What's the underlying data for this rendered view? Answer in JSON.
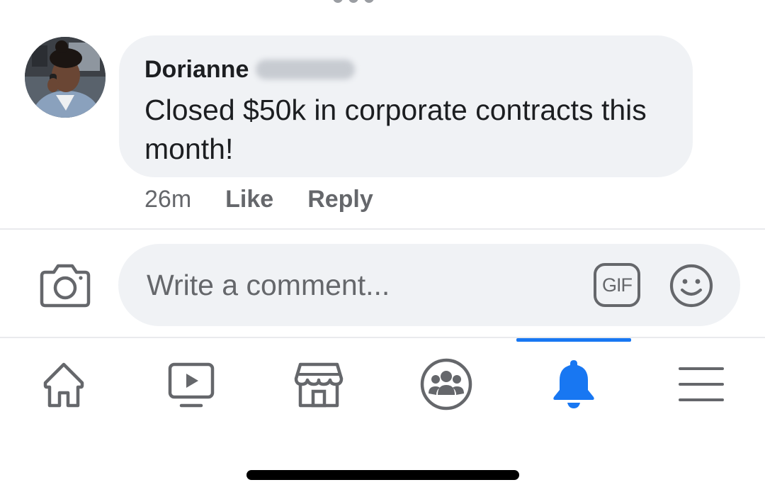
{
  "comment": {
    "author_name": "Dorianne",
    "text": "Closed $50k in corporate contracts this month!",
    "time": "26m",
    "like_label": "Like",
    "reply_label": "Reply"
  },
  "composer": {
    "placeholder": "Write a comment...",
    "gif_label": "GIF"
  },
  "bottom_nav": {
    "active_item": "notifications",
    "items": [
      {
        "name": "home",
        "icon": "home-icon"
      },
      {
        "name": "watch",
        "icon": "video-icon"
      },
      {
        "name": "marketplace",
        "icon": "storefront-icon"
      },
      {
        "name": "groups",
        "icon": "groups-icon"
      },
      {
        "name": "notifications",
        "icon": "bell-icon"
      },
      {
        "name": "menu",
        "icon": "hamburger-menu-icon"
      }
    ]
  },
  "colors": {
    "accent": "#1877f2",
    "bubble_background": "#f0f2f5",
    "secondary_text": "#65676b",
    "primary_text": "#1c1e21"
  }
}
